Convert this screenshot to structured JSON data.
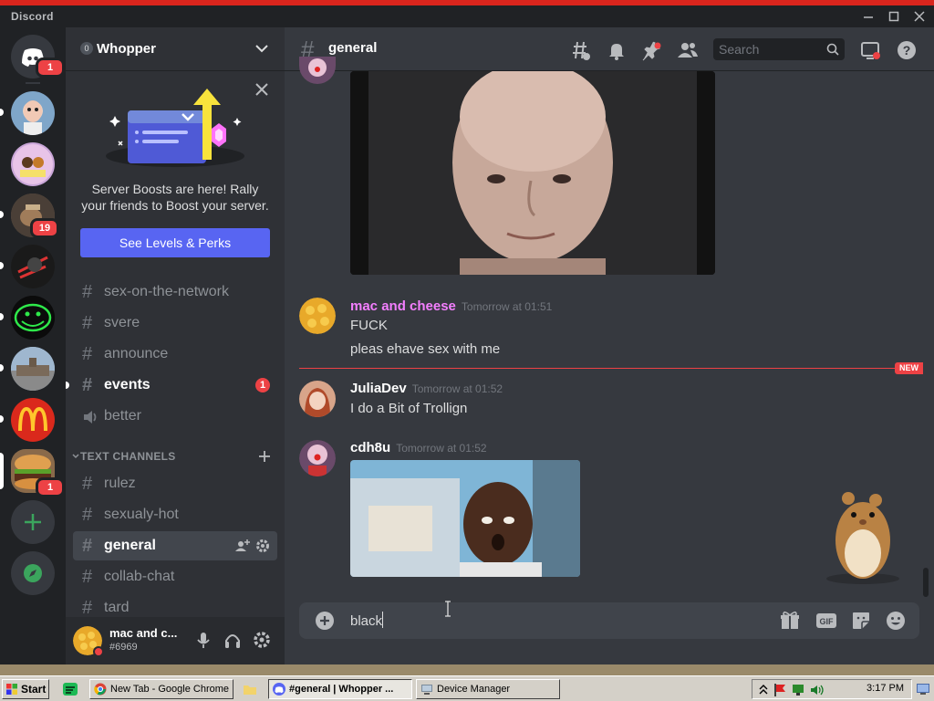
{
  "window": {
    "app_name": "Discord"
  },
  "servers": [
    {
      "id": "home",
      "badge": "1"
    },
    {
      "id": "server-2"
    },
    {
      "id": "server-3"
    },
    {
      "id": "server-4",
      "badge": "19"
    },
    {
      "id": "server-5"
    },
    {
      "id": "server-6"
    },
    {
      "id": "server-7"
    },
    {
      "id": "server-8"
    },
    {
      "id": "server-9-whopper",
      "badge": "1"
    }
  ],
  "guild": {
    "name": "Whopper",
    "boost_count": "0"
  },
  "boost_promo": {
    "text": "Server Boosts are here! Rally your friends to Boost your server.",
    "button": "See Levels & Perks"
  },
  "channels_top": [
    {
      "name": "sex-on-the-network"
    },
    {
      "name": "svere"
    },
    {
      "name": "announce"
    },
    {
      "name": "events",
      "mention": "1"
    },
    {
      "name": "better"
    }
  ],
  "category": {
    "label": "TEXT CHANNELS"
  },
  "channels_text": [
    {
      "name": "rulez"
    },
    {
      "name": "sexualy-hot"
    },
    {
      "name": "general"
    },
    {
      "name": "collab-chat"
    },
    {
      "name": "tard"
    }
  ],
  "user": {
    "name": "mac and c...",
    "tag": "#6969"
  },
  "chat": {
    "channel": "general",
    "search_placeholder": "Search",
    "messages": [
      {
        "author": "mac and cheese",
        "author_color": "#f47fff",
        "time": "Tomorrow at 01:51",
        "lines": [
          "FUCK",
          "pleas ehave sex with me"
        ]
      },
      {
        "author": "JuliaDev",
        "author_color": "#ffffff",
        "time": "Tomorrow at 01:52",
        "lines": [
          "I do a Bit of Trollign"
        ]
      },
      {
        "author": "cdh8u",
        "author_color": "#ffffff",
        "time": "Tomorrow at 01:52",
        "lines": []
      }
    ],
    "new_label": "NEW",
    "composer_value": "black"
  },
  "taskbar": {
    "start": "Start",
    "items": [
      {
        "label": "New Tab - Google Chrome"
      },
      {
        "label": "#general | Whopper ..."
      },
      {
        "label": "Device Manager"
      }
    ],
    "clock": "3:17 PM"
  },
  "colors": {
    "blurple": "#5865f2",
    "mention_red": "#ed4245",
    "bg_chat": "#36393f",
    "bg_sidebar": "#2f3136",
    "bg_rail": "#202225"
  }
}
